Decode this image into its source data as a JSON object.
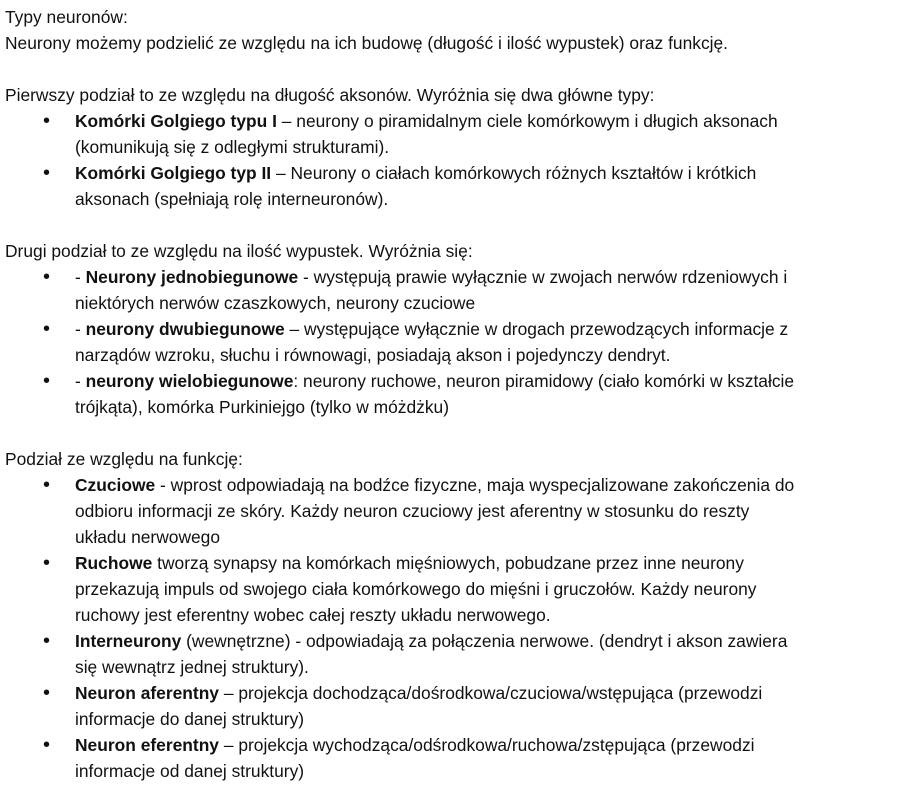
{
  "intro": {
    "title": "Typy neuronów:",
    "text": "Neurony możemy podzielić ze względu na ich budowę (długość i ilość wypustek) oraz funkcję."
  },
  "section1": {
    "heading": "Pierwszy podział to ze względu na długość aksonów. Wyróżnia się dwa główne typy:",
    "items": [
      {
        "term": "Komórki Golgiego typu I",
        "line1": " – neurony o piramidalnym ciele komórkowym i długich aksonach",
        "line2": "(komunikują się z odległymi strukturami)."
      },
      {
        "term": "Komórki Golgiego typ II",
        "line1": " – Neurony o ciałach komórkowych różnych kształtów i krótkich",
        "line2": "aksonach  (spełniają rolę interneuronów)."
      }
    ]
  },
  "section2": {
    "heading": "Drugi podział to ze względu na ilość wypustek. Wyróżnia się:",
    "items": [
      {
        "prefix": "- ",
        "term": "Neurony jednobiegunowe",
        "line1": " - występują prawie wyłącznie w zwojach nerwów rdzeniowych i",
        "line2": "niektórych nerwów czaszkowych, neurony czuciowe"
      },
      {
        "prefix": "- ",
        "term": "neurony dwubiegunowe",
        "line1": " – występujące wyłącznie w drogach przewodzących informacje z",
        "line2": "narządów wzroku, słuchu i równowagi, posiadają akson i pojedynczy dendryt."
      },
      {
        "prefix": "- ",
        "term": "neurony wielobiegunowe",
        "line1": ": neurony ruchowe, neuron piramidowy (ciało komórki w kształcie",
        "line2": "trójkąta), komórka Purkiniejgo (tylko w móżdżku)"
      }
    ]
  },
  "section3": {
    "heading": "Podział ze względu na funkcję:",
    "items": [
      {
        "term": "Czuciowe",
        "line1": " - wprost odpowiadają na bodźce fizyczne, maja wyspecjalizowane zakończenia do",
        "line2": "odbioru informacji ze skóry. Każdy neuron czuciowy jest aferentny w stosunku do reszty",
        "line3": "układu nerwowego"
      },
      {
        "term": "Ruchowe",
        "line1": "  tworzą synapsy na komórkach mięśniowych, pobudzane przez inne neurony",
        "line2": "przekazują impuls od swojego ciała komórkowego do mięśni i gruczołów. Każdy neurony",
        "line3": "ruchowy jest eferentny wobec całej reszty układu nerwowego."
      },
      {
        "term": "Interneurony",
        "line1": " (wewnętrzne) - odpowiadają za połączenia nerwowe. (dendryt i akson zawiera",
        "line2": "się wewnątrz jednej struktury)."
      },
      {
        "term": "Neuron aferentny",
        "line1": " – projekcja dochodząca/dośrodkowa/czuciowa/wstępująca (przewodzi",
        "line2": "informacje do danej struktury)"
      },
      {
        "term": "Neuron eferentny",
        "line1": " – projekcja wychodząca/odśrodkowa/ruchowa/zstępująca (przewodzi",
        "line2": "informacje od danej struktury)"
      }
    ]
  }
}
